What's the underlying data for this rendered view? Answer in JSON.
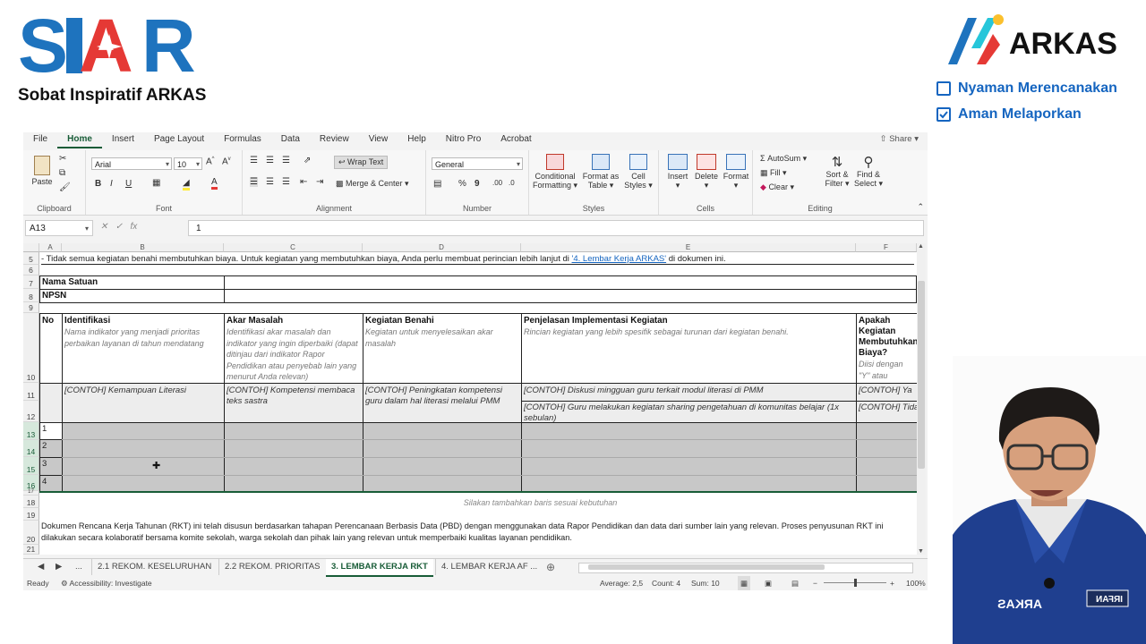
{
  "branding": {
    "siar_logo": "SIAR",
    "siar_tagline": "Sobat Inspiratif ARKAS",
    "arkas_logo": "ARKAS",
    "features": [
      "Nyaman Merencanakan",
      "Aman Melaporkan"
    ]
  },
  "excel": {
    "menu": [
      "File",
      "Home",
      "Insert",
      "Page Layout",
      "Formulas",
      "Data",
      "Review",
      "View",
      "Help",
      "Nitro Pro",
      "Acrobat"
    ],
    "share": "Share",
    "ribbon": {
      "clipboard": {
        "paste": "Paste",
        "label": "Clipboard"
      },
      "font": {
        "name": "Arial",
        "size": "10",
        "bold": "B",
        "italic": "I",
        "underline": "U",
        "label": "Font"
      },
      "alignment": {
        "wrap": "Wrap Text",
        "merge": "Merge & Center",
        "label": "Alignment"
      },
      "number": {
        "format": "General",
        "percent": "%",
        "comma": "9",
        "label": "Number"
      },
      "styles": {
        "conditional": "Conditional",
        "conditional2": "Formatting",
        "format_as": "Format as",
        "format_as2": "Table",
        "cell": "Cell",
        "cell2": "Styles",
        "label": "Styles"
      },
      "cells": {
        "insert": "Insert",
        "delete": "Delete",
        "format": "Format",
        "label": "Cells"
      },
      "editing": {
        "autosum": "AutoSum",
        "fill": "Fill",
        "clear": "Clear",
        "sort": "Sort &",
        "sort2": "Filter",
        "find": "Find &",
        "find2": "Select",
        "label": "Editing"
      }
    },
    "formula_bar": {
      "name_box": "A13",
      "fx": "fx",
      "value": "1"
    },
    "columns": [
      "A",
      "B",
      "C",
      "D",
      "E",
      "F"
    ],
    "rows": {
      "r5": "- Tidak semua kegiatan benahi membutuhkan biaya. Untuk kegiatan yang membutuhkan biaya, Anda perlu membuat perincian lebih lanjut di",
      "r5_link": "'4. Lembar Kerja ARKAS'",
      "r5_tail": "di dokumen ini.",
      "nama_satuan": "Nama Satuan",
      "npsn": "NPSN",
      "headers": {
        "no": "No",
        "identifikasi": "Identifikasi",
        "identifikasi_sub": "Nama indikator yang menjadi prioritas perbaikan layanan di tahun mendatang",
        "akar": "Akar Masalah",
        "akar_sub": "Identifikasi akar masalah dan indikator yang ingin diperbaiki (dapat ditinjau dari indikator Rapor Pendidikan atau penyebab lain yang menurut Anda relevan)",
        "kegiatan": "Kegiatan Benahi",
        "kegiatan_sub": "Kegiatan untuk menyelesaikan akar masalah",
        "penjelasan": "Penjelasan Implementasi Kegiatan",
        "penjelasan_sub": "Rincian kegiatan yang lebih spesifik sebagai turunan dari kegiatan benahi.",
        "apakah": "Apakah Kegiatan Membutuhkan Biaya?",
        "apakah_sub": "Diisi dengan \"Y\" atau \"Tidak\"."
      },
      "example": {
        "identifikasi": "[CONTOH] Kemampuan Literasi",
        "akar": "[CONTOH]  Kompetensi membaca teks sastra",
        "kegiatan": "[CONTOH] Peningkatan kompetensi guru dalam hal literasi melalui PMM",
        "penjelasan1": "[CONTOH] Diskusi mingguan guru terkait modul literasi di PMM",
        "penjelasan2": "[CONTOH] Guru melakukan kegiatan sharing pengetahuan di komunitas belajar (1x sebulan)",
        "apakah1": "[CONTOH] Ya",
        "apakah2": "[CONTOH] Tidak"
      },
      "entry_numbers": [
        "1",
        "2",
        "3",
        "4"
      ],
      "r18": "Silakan tambahkan baris sesuai kebutuhan",
      "r20": "Dokumen Rencana Kerja Tahunan (RKT) ini telah disusun berdasarkan tahapan Perencanaan Berbasis Data (PBD) dengan menggunakan data Rapor Pendidikan dan data dari sumber lain yang relevan. Proses penyusunan RKT ini dilakukan secara kolaboratif bersama komite sekolah, warga sekolah dan pihak lain yang relevan untuk memperbaiki kualitas layanan pendidikan."
    },
    "row_numbers": [
      "5",
      "6",
      "7",
      "8",
      "9",
      "10",
      "11",
      "12",
      "13",
      "14",
      "15",
      "16",
      "17",
      "18",
      "19",
      "20",
      "21"
    ],
    "tabs": [
      "...",
      "2.1 REKOM. KESELURUHAN",
      "2.2 REKOM. PRIORITAS",
      "3. LEMBAR KERJA RKT",
      "4. LEMBAR KERJA AF ..."
    ],
    "status": {
      "ready": "Ready",
      "accessibility": "Accessibility: Investigate",
      "average": "Average: 2,5",
      "count": "Count: 4",
      "sum": "Sum: 10",
      "zoom": "100%"
    }
  },
  "webcam": {
    "badge_text": "ARKAS",
    "name_tag": "IRFAN"
  }
}
